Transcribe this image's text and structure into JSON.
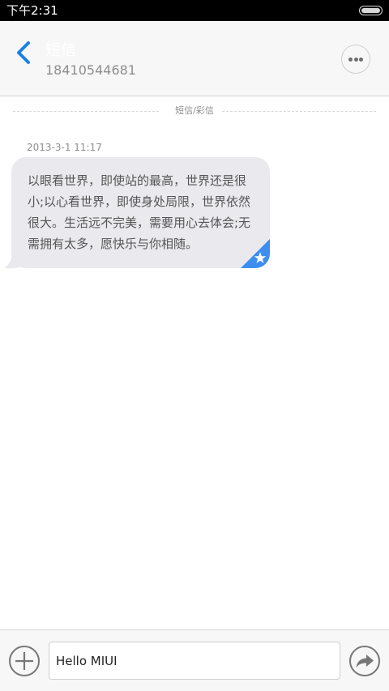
{
  "status_bar": {
    "time": "下午2:31",
    "battery_icon": "battery-icon"
  },
  "header": {
    "back_icon": "chevron-left-icon",
    "contact_name": "短信",
    "contact_number": "18410544681",
    "more_icon": "more-horizontal-icon"
  },
  "conversation": {
    "divider_label": "短信/彩信",
    "messages": [
      {
        "timestamp": "2013-3-1 11:17",
        "text": "以眼看世界，即使站的最高，世界还是很小;以心看世界，即使身处局限，世界依然很大。生活远不完美，需要用心去体会;无需拥有太多，愿快乐与你相随。",
        "starred": true,
        "star_icon": "star-icon"
      }
    ]
  },
  "composer": {
    "add_icon": "plus-circle-icon",
    "input_value": "Hello MIUI",
    "send_icon": "send-icon"
  },
  "colors": {
    "accent": "#1a82e6",
    "bubble": "#e9e9ee",
    "star_corner": "#3d8ef0",
    "status_bar": "#000000",
    "header_bg": "#f7f7f7"
  }
}
